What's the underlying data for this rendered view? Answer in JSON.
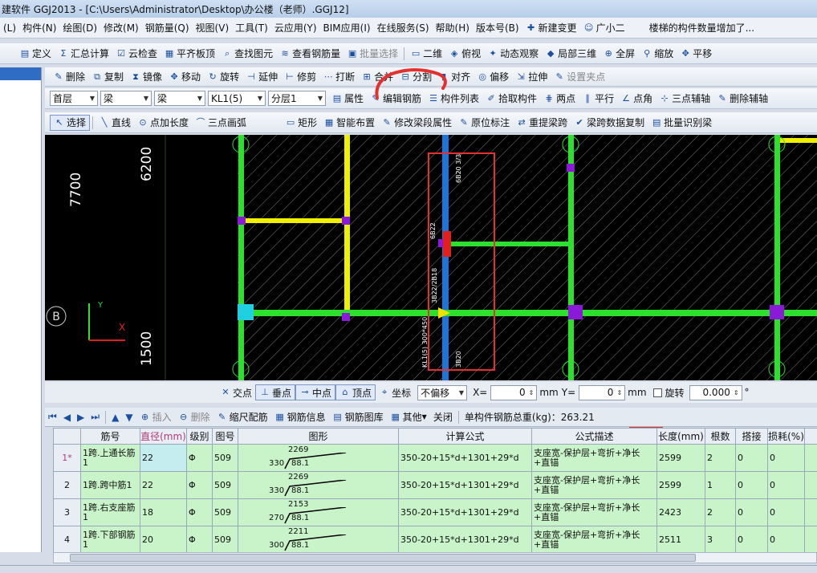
{
  "title_bar": "建软件 GGJ2013 - [C:\\Users\\Administrator\\Desktop\\办公楼（老师）.GGJ12]",
  "menu": [
    "(L)",
    "构件(N)",
    "绘图(D)",
    "修改(M)",
    "钢筋量(Q)",
    "视图(V)",
    "工具(T)",
    "云应用(Y)",
    "BIM应用(I)",
    "在线服务(S)",
    "帮助(H)",
    "版本号(B)",
    "新建变更",
    "广小二"
  ],
  "notice": "楼梯的构件数量增加了...",
  "tb1": [
    "定义",
    "汇总计算",
    "云检查",
    "平齐板顶",
    "查找图元",
    "查看钢筋量",
    "批量选择",
    "二维",
    "俯视",
    "动态观察",
    "局部三维",
    "全屏",
    "缩放",
    "平移"
  ],
  "tb2": [
    "删除",
    "复制",
    "镜像",
    "移动",
    "旋转",
    "延伸",
    "修剪",
    "打断",
    "合并",
    "分割",
    "对齐",
    "偏移",
    "拉伸",
    "设置夹点"
  ],
  "tb3": {
    "floor": "首层",
    "type1": "梁",
    "type2": "梁",
    "component": "KL1(5)",
    "layer": "分层1",
    "items": [
      "属性",
      "编辑钢筋",
      "构件列表",
      "拾取构件",
      "两点",
      "平行",
      "点角",
      "三点辅轴",
      "删除辅轴"
    ]
  },
  "tb4": [
    "选择",
    "直线",
    "点加长度",
    "三点画弧",
    "矩形",
    "智能布置",
    "修改梁段属性",
    "原位标注",
    "重提梁跨",
    "梁跨数据复制",
    "批量识别梁"
  ],
  "canvas": {
    "dim_7700": "7700",
    "dim_6200": "6200",
    "dim_1500": "1500",
    "axis_b": "B",
    "axis_y": "Y",
    "axis_x": "X",
    "beam_label_1": "6B20 3/3",
    "beam_label_2": "KL1(5) 300*450",
    "beam_label_3": "3B22/2B18",
    "beam_label_4": "6B22",
    "beam_label_5": "3B20"
  },
  "coord_bar": {
    "intersect": "交点",
    "perp": "垂点",
    "mid": "中点",
    "vertex": "顶点",
    "coord": "坐标",
    "offset": "不偏移",
    "x_label": "X=",
    "x_val": "0",
    "unit1": "mm",
    "y_label": "Y=",
    "y_val": "0",
    "unit2": "mm",
    "rotate": "旋转",
    "rot_val": "0.000",
    "deg": "°"
  },
  "grid_toolbar": {
    "insert": "插入",
    "delete": "删除",
    "ruler": "缩尺配筋",
    "info": "钢筋信息",
    "lib": "钢筋图库",
    "other": "其他",
    "close": "关闭",
    "total": "单构件钢筋总重(kg)：263.21"
  },
  "columns": [
    "筋号",
    "直径(mm)",
    "级别",
    "图号",
    "图形",
    "计算公式",
    "公式描述",
    "长度(mm)",
    "根数",
    "搭接",
    "损耗(%)"
  ],
  "rows": [
    {
      "n": "1*",
      "name": "1跨.上通长筋1",
      "dia": "22",
      "grade": "Φ",
      "fig": "509",
      "shape_top": "2269",
      "shape_left": "330",
      "shape_mid": "88.1",
      "formula": "350-20+15*d+1301+29*d",
      "desc": "支座宽-保护层+弯折+净长+直锚",
      "len": "2599",
      "count": "2",
      "lap": "0",
      "loss": "0"
    },
    {
      "n": "2",
      "name": "1跨.跨中筋1",
      "dia": "22",
      "grade": "Φ",
      "fig": "509",
      "shape_top": "2269",
      "shape_left": "330",
      "shape_mid": "88.1",
      "formula": "350-20+15*d+1301+29*d",
      "desc": "支座宽-保护层+弯折+净长+直锚",
      "len": "2599",
      "count": "1",
      "lap": "0",
      "loss": "0"
    },
    {
      "n": "3",
      "name": "1跨.右支座筋1",
      "dia": "18",
      "grade": "Φ",
      "fig": "509",
      "shape_top": "2153",
      "shape_left": "270",
      "shape_mid": "88.1",
      "formula": "350-20+15*d+1301+29*d",
      "desc": "支座宽-保护层+弯折+净长+直锚",
      "len": "2423",
      "count": "2",
      "lap": "0",
      "loss": "0"
    },
    {
      "n": "4",
      "name": "1跨.下部钢筋1",
      "dia": "20",
      "grade": "Φ",
      "fig": "509",
      "shape_top": "2211",
      "shape_left": "300",
      "shape_mid": "88.1",
      "formula": "350-20+15*d+1301+29*d",
      "desc": "支座宽-保护层+弯折+净长+直锚",
      "len": "2511",
      "count": "3",
      "lap": "0",
      "loss": "0"
    }
  ]
}
